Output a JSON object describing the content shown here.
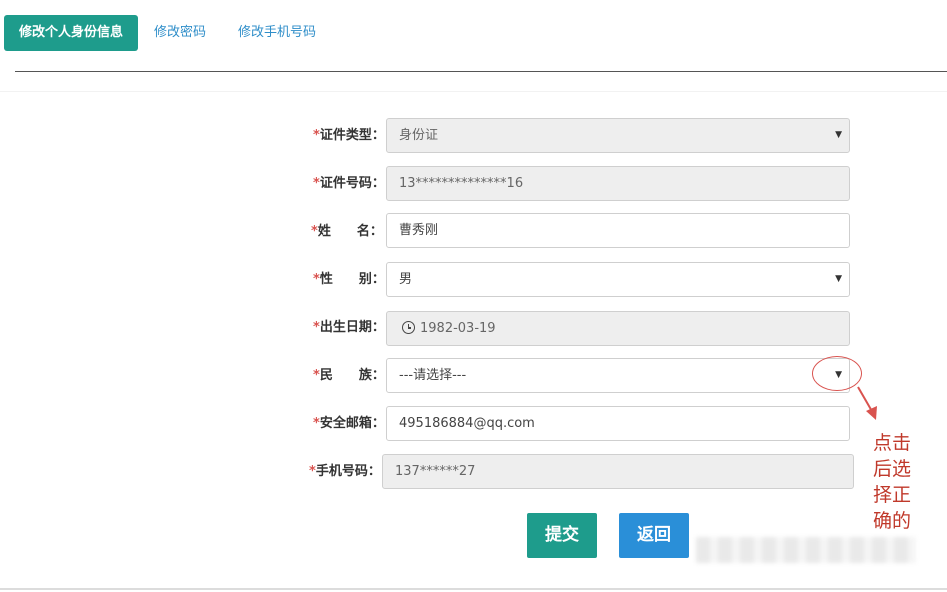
{
  "tabs": {
    "active": "修改个人身份信息",
    "password": "修改密码",
    "phone": "修改手机号码"
  },
  "form": {
    "required_mark": "*",
    "id_type": {
      "label": "证件类型：",
      "value": "身份证"
    },
    "id_number": {
      "label": "证件号码：",
      "value": "13**************16"
    },
    "name": {
      "label": "姓　　名：",
      "value": "曹秀刚"
    },
    "gender": {
      "label": "性　　别：",
      "value": "男"
    },
    "birth_date": {
      "label": "出生日期：",
      "value": "1982-03-19"
    },
    "ethnicity": {
      "label": "民　　族：",
      "value": "---请选择---"
    },
    "email": {
      "label": "安全邮箱：",
      "value": "495186884@qq.com"
    },
    "phone": {
      "label": "手机号码：",
      "value": "137******27"
    }
  },
  "buttons": {
    "submit": "提交",
    "back": "返回"
  },
  "annotation": {
    "text": "点击后选择正确的",
    "color": "#c0392b"
  },
  "colors": {
    "primary_teal": "#1e9c8c",
    "back_blue": "#2a8fd8",
    "link_blue": "#2f8ec9",
    "required_red": "#d9534f"
  },
  "icons": {
    "dropdown": "caret-down-icon",
    "date": "clock-icon",
    "annotation_arrow": "arrow-down-icon"
  }
}
